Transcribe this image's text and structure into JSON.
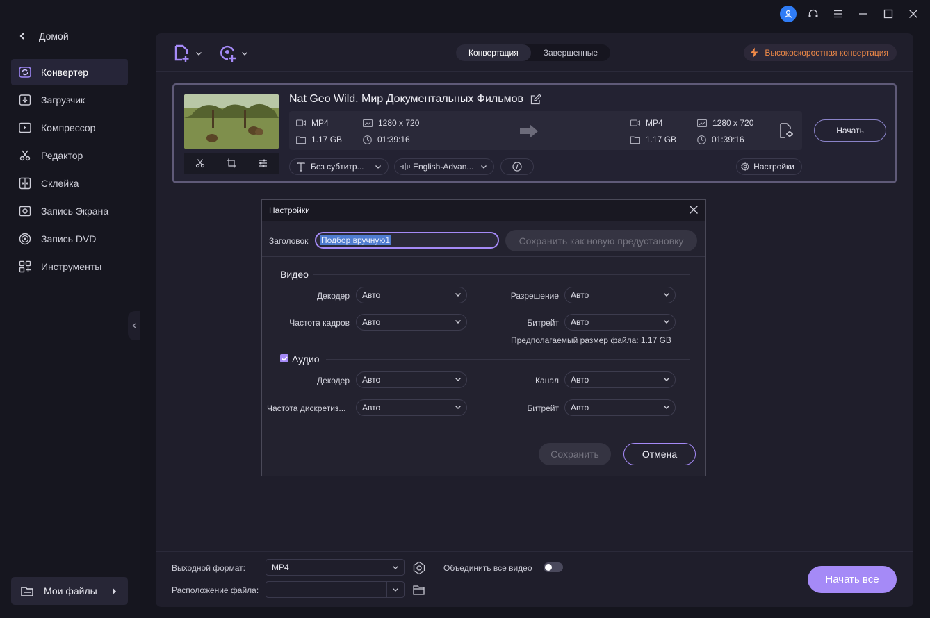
{
  "sidebar": {
    "home_label": "Домой",
    "items": [
      {
        "label": "Конвертер",
        "icon": "converter-icon",
        "active": true
      },
      {
        "label": "Загрузчик",
        "icon": "download-icon"
      },
      {
        "label": "Компрессор",
        "icon": "compress-icon"
      },
      {
        "label": "Редактор",
        "icon": "scissors-icon"
      },
      {
        "label": "Склейка",
        "icon": "merge-icon"
      },
      {
        "label": "Запись Экрана",
        "icon": "screen-record-icon"
      },
      {
        "label": "Запись DVD",
        "icon": "dvd-icon"
      },
      {
        "label": "Инструменты",
        "icon": "tools-icon"
      }
    ],
    "my_files_label": "Мои файлы"
  },
  "toolbar": {
    "tabs": [
      {
        "label": "Конвертация",
        "active": true
      },
      {
        "label": "Завершенные",
        "active": false
      }
    ],
    "high_speed_label": "Высокоскоростная конвертация"
  },
  "file": {
    "title": "Nat Geo Wild. Мир Документальных Фильмов",
    "source": {
      "format": "MP4",
      "resolution": "1280 x 720",
      "size": "1.17 GB",
      "duration": "01:39:16"
    },
    "target": {
      "format": "MP4",
      "resolution": "1280 x 720",
      "size": "1.17 GB",
      "duration": "01:39:16"
    },
    "start_label": "Начать",
    "subtitle_label": "Без субтитр...",
    "audio_label": "English-Advan...",
    "settings_label": "Настройки"
  },
  "bottom": {
    "output_format_label": "Выходной формат:",
    "output_format_value": "MP4",
    "merge_label": "Объединить все видео",
    "merge_enabled": false,
    "location_label": "Расположение файла:",
    "location_value": "",
    "start_all_label": "Начать все"
  },
  "dialog": {
    "title": "Настройки",
    "name_label": "Заголовок",
    "name_value": "Подбор вручную1",
    "save_preset_label": "Сохранить как новую предустановку",
    "video_section": "Видео",
    "video": {
      "decoder_label": "Декодер",
      "decoder_value": "Авто",
      "resolution_label": "Разрешение",
      "resolution_value": "Авто",
      "framerate_label": "Частота кадров",
      "framerate_value": "Авто",
      "bitrate_label": "Битрейт",
      "bitrate_value": "Авто"
    },
    "estimated_size": "Предполагаемый размер файла: 1.17 GB",
    "audio_section": "Аудио",
    "audio_enabled": true,
    "audio": {
      "decoder_label": "Декодер",
      "decoder_value": "Авто",
      "channel_label": "Канал",
      "channel_value": "Авто",
      "samplerate_label": "Частота дискретиз...",
      "samplerate_value": "Авто",
      "bitrate_label": "Битрейт",
      "bitrate_value": "Авто"
    },
    "save_label": "Сохранить",
    "cancel_label": "Отмена"
  },
  "colors": {
    "accent": "#a58af7",
    "high_speed": "#f08a48",
    "avatar": "#2f7cf6"
  }
}
